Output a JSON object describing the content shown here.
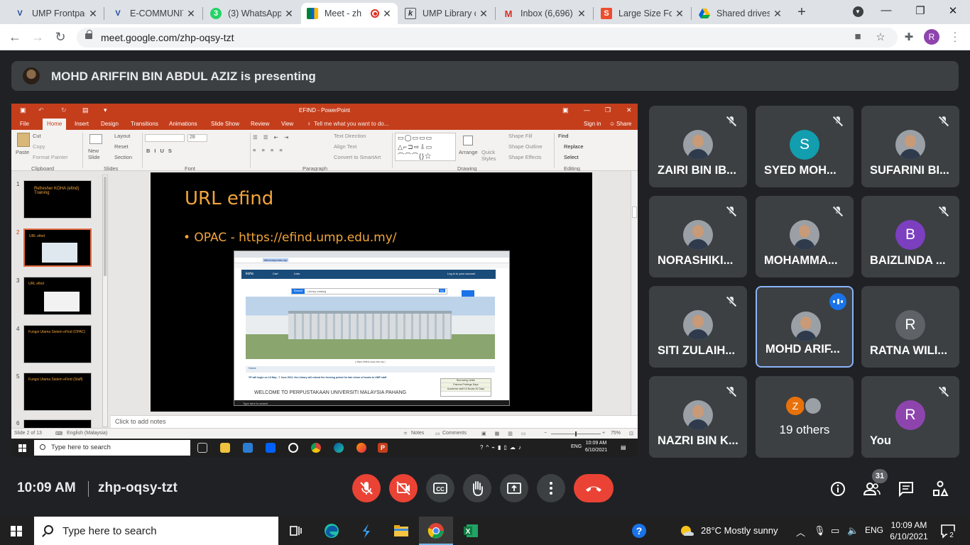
{
  "browser": {
    "tabs": [
      {
        "label": "UMP Frontpag",
        "favicon": "ump-icon"
      },
      {
        "label": "E-COMMUNIT",
        "favicon": "ump-icon"
      },
      {
        "label": "(3) WhatsApp",
        "favicon": "whatsapp-icon"
      },
      {
        "label": "Meet - zh",
        "favicon": "meet-icon",
        "recording": true
      },
      {
        "label": "UMP Library c",
        "favicon": "koha-icon"
      },
      {
        "label": "Inbox (6,696)",
        "favicon": "gmail-icon"
      },
      {
        "label": "Large Size Fol",
        "favicon": "shop-icon"
      },
      {
        "label": "Shared drives",
        "favicon": "drive-icon"
      }
    ],
    "url": "meet.google.com/zhp-oqsy-tzt",
    "profile_initial": "R"
  },
  "presenting": {
    "text": "MOHD ARIFFIN BIN ABDUL AZIZ is presenting"
  },
  "ppt": {
    "window_title": "EFIND - PowerPoint",
    "sign_in": "Sign in",
    "share": "Share",
    "tell_me": "Tell me what you want to do...",
    "menu": [
      "File",
      "Home",
      "Insert",
      "Design",
      "Transitions",
      "Animations",
      "Slide Show",
      "Review",
      "View"
    ],
    "ribbon": {
      "paste": "Paste",
      "cut": "Cut",
      "copy": "Copy",
      "format_painter": "Format Painter",
      "new_slide": "New Slide",
      "layout": "Layout",
      "reset": "Reset",
      "section": "Section",
      "font_size": "28",
      "text_direction": "Text Direction",
      "align_text": "Align Text",
      "convert_smartart": "Convert to SmartArt",
      "arrange": "Arrange",
      "quick_styles": "Quick Styles",
      "shape_fill": "Shape Fill",
      "shape_outline": "Shape Outline",
      "shape_effects": "Shape Effects",
      "find": "Find",
      "replace": "Replace",
      "select": "Select",
      "groups": [
        "Clipboard",
        "Slides",
        "Font",
        "Paragraph",
        "Drawing",
        "Editing"
      ]
    },
    "thumbnails": [
      {
        "num": "1",
        "text": "Refresher KOHA (efind) Training"
      },
      {
        "num": "2",
        "text": "URL efind"
      },
      {
        "num": "3",
        "text": "URL efind"
      },
      {
        "num": "4",
        "text": "Fungsi Utama Sistem eFind (OPAC)"
      },
      {
        "num": "5",
        "text": "Fungsi Utama Sistem eFind (Staff)"
      },
      {
        "num": "6",
        "text": ""
      }
    ],
    "slide": {
      "title": "URL efind",
      "bullet": "• OPAC - https://efind.ump.edu.my/",
      "shot": {
        "url": "efind.ump.edu.my",
        "nav_logo": "koha",
        "nav_cart": "Cart",
        "nav_lists": "Lists",
        "nav_login": "Log in to your account",
        "search_label": "Search",
        "search_select": "Library catalog",
        "go": "Go",
        "adv_search": "Advanced search",
        "new_book": "New Book List",
        "uni_name": "UNIVERSITI MALAYSIA PAHANG",
        "caption": "( https://efind.ump.edu.my )",
        "home": "Home",
        "notice": "*IP will begin on 10 May - 7 June 2021. the Library will extend the freezing period for late return of books to UMP staff",
        "welcome": "WELCOME TO PERPUSTAKAAN UNIVERSITI MALAYSIA PAHANG",
        "table": [
          "Borrowing Limits",
          "Patrons   Privilege   Days",
          "Academic staff  15 Books  30 Days"
        ],
        "taskbar_search": "Type here to search"
      }
    },
    "notes_placeholder": "Click to add notes",
    "status": {
      "slide_of": "Slide 2 of 13",
      "language": "English (Malaysia)",
      "notes": "Notes",
      "comments": "Comments",
      "zoom": "75%"
    },
    "taskbar": {
      "search": "Type here to search",
      "lang": "ENG",
      "time": "10:09 AM",
      "date": "6/10/2021"
    }
  },
  "participants": [
    {
      "name": "ZAIRI BIN IB...",
      "avatar": "photo",
      "muted": true
    },
    {
      "name": "SYED MOH...",
      "avatar": "S",
      "color": "#129eaf",
      "muted": true
    },
    {
      "name": "SUFARINI BI...",
      "avatar": "photo",
      "muted": true
    },
    {
      "name": "NORASHIKI...",
      "avatar": "photo",
      "muted": true
    },
    {
      "name": "MOHAMMA...",
      "avatar": "photo",
      "muted": true
    },
    {
      "name": "BAIZLINDA ...",
      "avatar": "B",
      "color": "#7b3fbf",
      "muted": true
    },
    {
      "name": "SITI ZULAIH...",
      "avatar": "photo",
      "muted": true
    },
    {
      "name": "MOHD ARIF...",
      "avatar": "photo",
      "muted": false,
      "speaking": true
    },
    {
      "name": "RATNA WILI...",
      "avatar": "R",
      "color": "#5f6368",
      "muted": false
    },
    {
      "name": "NAZRI BIN K...",
      "avatar": "photo",
      "muted": true
    },
    {
      "name": "You",
      "avatar": "R",
      "color": "#8e44ad",
      "muted": true
    }
  ],
  "others": {
    "label": "19 others",
    "initial": "Z",
    "color": "#e8710a"
  },
  "meet_bar": {
    "time": "10:09 AM",
    "code": "zhp-oqsy-tzt",
    "people_count": "31"
  },
  "taskbar": {
    "search": "Type here to search",
    "weather": "28°C  Mostly sunny",
    "lang": "ENG",
    "time": "10:09 AM",
    "date": "6/10/2021",
    "notifications": "2"
  }
}
